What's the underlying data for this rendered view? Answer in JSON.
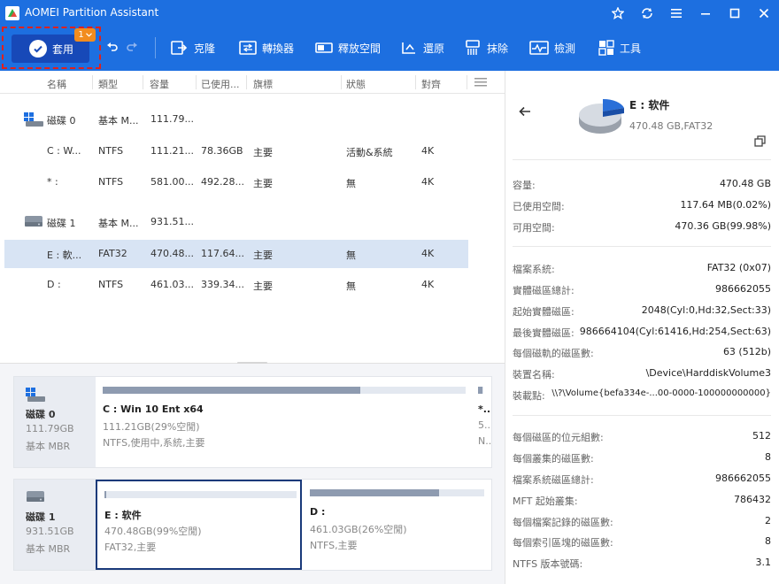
{
  "app": {
    "title": "AOMEI Partition Assistant"
  },
  "toolbar": {
    "apply_label": "套用",
    "pending_count": "1",
    "tools": [
      "克隆",
      "轉換器",
      "釋放空間",
      "還原",
      "抹除",
      "檢測",
      "工具"
    ]
  },
  "table": {
    "headers": [
      "名稱",
      "類型",
      "容量",
      "已使用...",
      "旗標",
      "狀態",
      "對齊"
    ],
    "rows": [
      {
        "kind": "disk",
        "name": "磁碟 0",
        "type": "基本 M...",
        "capacity": "111.79...",
        "used": "",
        "flag": "",
        "status": "",
        "align": ""
      },
      {
        "kind": "part",
        "name": "C : W...",
        "type": "NTFS",
        "capacity": "111.21...",
        "used": "78.36GB",
        "flag": "主要",
        "status": "活動&系統",
        "align": "4K"
      },
      {
        "kind": "part",
        "name": "* :",
        "type": "NTFS",
        "capacity": "581.00...",
        "used": "492.28...",
        "flag": "主要",
        "status": "無",
        "align": "4K"
      },
      {
        "kind": "disk",
        "name": "磁碟 1",
        "type": "基本 M...",
        "capacity": "931.51...",
        "used": "",
        "flag": "",
        "status": "",
        "align": ""
      },
      {
        "kind": "part",
        "name": "E : 軟...",
        "type": "FAT32",
        "capacity": "470.48...",
        "used": "117.64...",
        "flag": "主要",
        "status": "無",
        "align": "4K",
        "selected": true
      },
      {
        "kind": "part",
        "name": "D :",
        "type": "NTFS",
        "capacity": "461.03...",
        "used": "339.34...",
        "flag": "主要",
        "status": "無",
        "align": "4K"
      }
    ]
  },
  "diskmap": [
    {
      "name": "磁碟 0",
      "size": "111.79GB",
      "type": "基本 MBR",
      "partitions": [
        {
          "name": "C : Win 10 Ent x64",
          "free": "111.21GB(29%空閒)",
          "info": "NTFS,使用中,系統,主要",
          "used_fraction": 0.71
        },
        {
          "name": "*...",
          "free": "5...",
          "info": "N...",
          "used_fraction": 0.85
        }
      ]
    },
    {
      "name": "磁碟 1",
      "size": "931.51GB",
      "type": "基本 MBR",
      "partitions": [
        {
          "name": "E : 软件",
          "free": "470.48GB(99%空閒)",
          "info": "FAT32,主要",
          "used_fraction": 0.01,
          "selected": true
        },
        {
          "name": "D :",
          "free": "461.03GB(26%空閒)",
          "info": "NTFS,主要",
          "used_fraction": 0.74
        }
      ]
    }
  ],
  "details": {
    "title": "E : 软件",
    "subtitle": "470.48 GB,FAT32",
    "group1": [
      {
        "k": "容量:",
        "v": "470.48 GB"
      },
      {
        "k": "已使用空間:",
        "v": "117.64 MB(0.02%)"
      },
      {
        "k": "可用空間:",
        "v": "470.36 GB(99.98%)"
      }
    ],
    "group2": [
      {
        "k": "檔案系統:",
        "v": "FAT32 (0x07)"
      },
      {
        "k": "實體磁區總計:",
        "v": "986662055"
      },
      {
        "k": "起始實體磁區:",
        "v": "2048(Cyl:0,Hd:32,Sect:33)"
      },
      {
        "k": "最後實體磁區:",
        "v": "986664104(Cyl:61416,Hd:254,Sect:63)"
      },
      {
        "k": "每個磁軌的磁區數:",
        "v": "63 (512b)"
      },
      {
        "k": "裝置名稱:",
        "v": "\\Device\\HarddiskVolume3"
      },
      {
        "k": "裝載點:",
        "v": "\\\\?\\Volume{befa334e-...00-0000-100000000000}"
      }
    ],
    "group3": [
      {
        "k": "每個磁區的位元組數:",
        "v": "512"
      },
      {
        "k": "每個叢集的磁區數:",
        "v": "8"
      },
      {
        "k": "檔案系統磁區總計:",
        "v": "986662055"
      },
      {
        "k": "MFT 起始叢集:",
        "v": "786432"
      },
      {
        "k": "每個檔案記錄的磁區數:",
        "v": "2"
      },
      {
        "k": "每個索引區塊的磁區數:",
        "v": "8"
      },
      {
        "k": "NTFS 版本號碼:",
        "v": "3.1"
      }
    ]
  },
  "colors": {
    "accent": "#1d6fe0",
    "apply": "#1749b8",
    "badge": "#f28c1e",
    "selected_row": "#d8e4f4"
  }
}
